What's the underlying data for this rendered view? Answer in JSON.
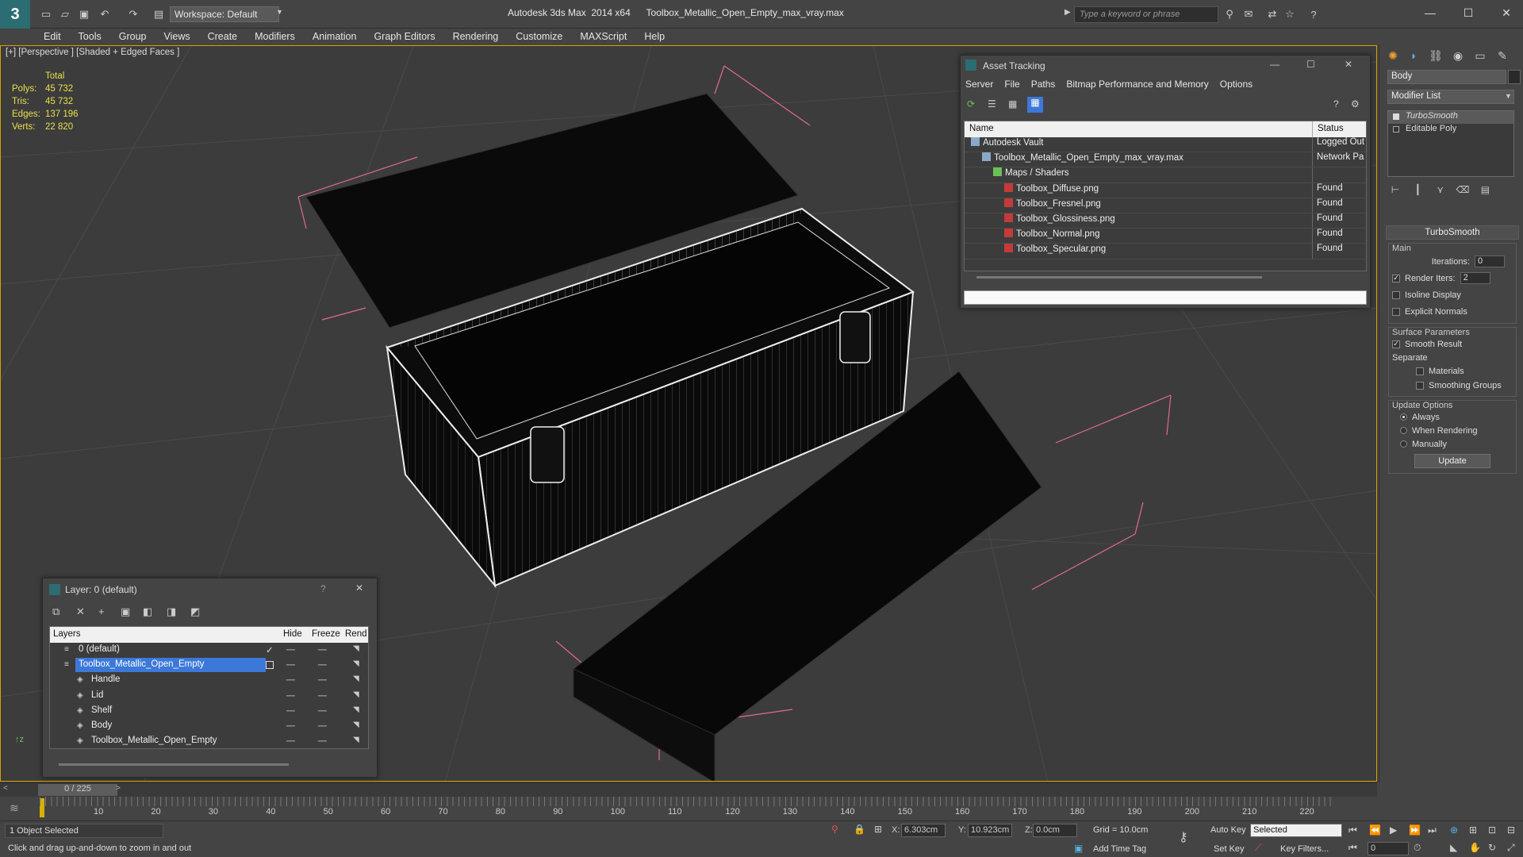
{
  "app": {
    "title": "Autodesk 3ds Max  2014 x64      Toolbox_Metallic_Open_Empty_max_vray.max",
    "workspace": "Workspace: Default",
    "search_placeholder": "Type a keyword or phrase"
  },
  "menubar": [
    "Edit",
    "Tools",
    "Group",
    "Views",
    "Create",
    "Modifiers",
    "Animation",
    "Graph Editors",
    "Rendering",
    "Customize",
    "MAXScript",
    "Help"
  ],
  "viewport": {
    "label": "[+] [Perspective ] [Shaded + Edged Faces ]",
    "stats": {
      "total_label": "Total",
      "rows": [
        {
          "label": "Polys:",
          "value": "45 732"
        },
        {
          "label": "Tris:",
          "value": "45 732"
        },
        {
          "label": "Edges:",
          "value": "137 196"
        },
        {
          "label": "Verts:",
          "value": "22 820"
        }
      ]
    }
  },
  "asset_tracking": {
    "title": "Asset Tracking",
    "menu": [
      "Server",
      "File",
      "Paths",
      "Bitmap Performance and Memory",
      "Options"
    ],
    "columns": [
      "Name",
      "Status"
    ],
    "rows": [
      {
        "name": "Autodesk Vault",
        "status": "Logged Out",
        "indent": 0
      },
      {
        "name": "Toolbox_Metallic_Open_Empty_max_vray.max",
        "status": "Network Pa",
        "indent": 1
      },
      {
        "name": "Maps / Shaders",
        "status": "",
        "indent": 2
      },
      {
        "name": "Toolbox_Diffuse.png",
        "status": "Found",
        "indent": 3
      },
      {
        "name": "Toolbox_Fresnel.png",
        "status": "Found",
        "indent": 3
      },
      {
        "name": "Toolbox_Glossiness.png",
        "status": "Found",
        "indent": 3
      },
      {
        "name": "Toolbox_Normal.png",
        "status": "Found",
        "indent": 3
      },
      {
        "name": "Toolbox_Specular.png",
        "status": "Found",
        "indent": 3
      }
    ]
  },
  "layer_window": {
    "title": "Layer: 0 (default)",
    "help": "?",
    "columns": [
      "Layers",
      "Hide",
      "Freeze",
      "Rend"
    ],
    "rows": [
      {
        "name": "0 (default)",
        "indent": 0,
        "selected": false
      },
      {
        "name": "Toolbox_Metallic_Open_Empty",
        "indent": 0,
        "selected": true
      },
      {
        "name": "Handle",
        "indent": 1,
        "selected": false
      },
      {
        "name": "Lid",
        "indent": 1,
        "selected": false
      },
      {
        "name": "Shelf",
        "indent": 1,
        "selected": false
      },
      {
        "name": "Body",
        "indent": 1,
        "selected": false
      },
      {
        "name": "Toolbox_Metallic_Open_Empty",
        "indent": 1,
        "selected": false
      }
    ]
  },
  "command_panel": {
    "object_name": "Body",
    "modifier_list": "Modifier List",
    "stack": [
      "TurboSmooth",
      "Editable Poly"
    ],
    "rollout_title": "TurboSmooth",
    "main_label": "Main",
    "iterations_label": "Iterations:",
    "iterations_value": "0",
    "render_iters_label": "Render Iters:",
    "render_iters_value": "2",
    "isoline": "Isoline Display",
    "explicit_normals": "Explicit Normals",
    "surface_params": "Surface Parameters",
    "smooth_result": "Smooth Result",
    "separate": "Separate",
    "materials": "Materials",
    "smoothing_groups": "Smoothing Groups",
    "update_options": "Update Options",
    "always": "Always",
    "when_rendering": "When Rendering",
    "manually": "Manually",
    "update_button": "Update"
  },
  "timeline": {
    "slider_label": "0 / 225",
    "ticks": [
      "10",
      "20",
      "30",
      "40",
      "50",
      "60",
      "70",
      "80",
      "90",
      "100",
      "110",
      "120",
      "130",
      "140",
      "150",
      "160",
      "170",
      "180",
      "190",
      "200",
      "210",
      "220"
    ]
  },
  "status": {
    "selection": "1 Object Selected",
    "prompt": "Click and drag up-and-down to zoom in and out",
    "x_label": "X:",
    "x_value": "6.303cm",
    "y_label": "Y:",
    "y_value": "10.923cm",
    "z_label": "Z:",
    "z_value": "0.0cm",
    "grid": "Grid = 10.0cm",
    "add_time_tag": "Add Time Tag",
    "auto_key": "Auto Key",
    "set_key": "Set Key",
    "selected_dropdown": "Selected",
    "key_filters": "Key Filters...",
    "frame_value": "0"
  }
}
